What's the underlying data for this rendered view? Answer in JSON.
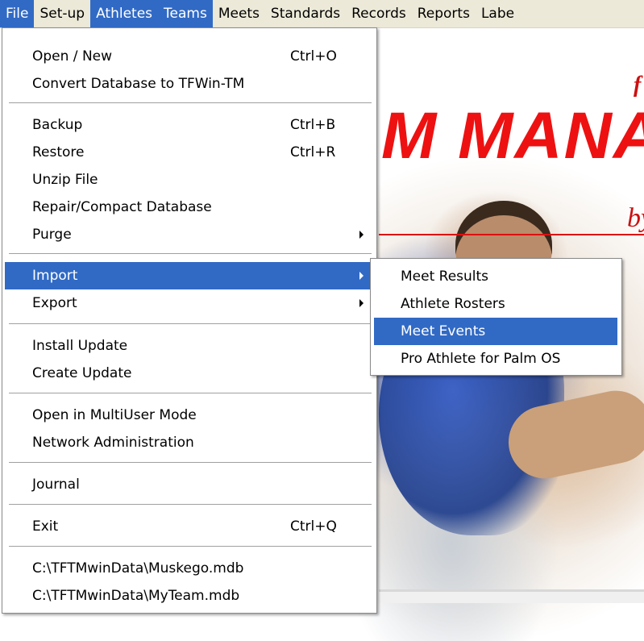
{
  "menubar": {
    "items": [
      "File",
      "Set-up",
      "Athletes",
      "Teams",
      "Meets",
      "Standards",
      "Records",
      "Reports",
      "Labe"
    ]
  },
  "file_menu": {
    "open_new": {
      "label": "Open / New",
      "shortcut": "Ctrl+O"
    },
    "convert": {
      "label": "Convert Database to TFWin-TM"
    },
    "backup": {
      "label": "Backup",
      "shortcut": "Ctrl+B"
    },
    "restore": {
      "label": "Restore",
      "shortcut": "Ctrl+R"
    },
    "unzip": {
      "label": "Unzip File"
    },
    "repair": {
      "label": "Repair/Compact Database"
    },
    "purge": {
      "label": "Purge"
    },
    "import": {
      "label": "Import"
    },
    "export": {
      "label": "Export"
    },
    "install_update": {
      "label": "Install Update"
    },
    "create_update": {
      "label": "Create Update"
    },
    "multiuser": {
      "label": "Open in MultiUser Mode"
    },
    "network_admin": {
      "label": "Network Administration"
    },
    "journal": {
      "label": "Journal"
    },
    "exit": {
      "label": "Exit",
      "shortcut": "Ctrl+Q"
    },
    "recent": [
      "C:\\TFTMwinData\\Muskego.mdb",
      "C:\\TFTMwinData\\MyTeam.mdb"
    ]
  },
  "import_menu": {
    "items": [
      "Meet Results",
      "Athlete Rosters",
      "Meet Events",
      "Pro Athlete for Palm OS"
    ],
    "highlighted": "Meet Events"
  },
  "splash": {
    "logo_text": "M MANA",
    "byline": "by",
    "top_fragment": "f"
  },
  "colors": {
    "menu_highlight": "#316ac5",
    "logo_red": "#ee1111",
    "menubar_bg": "#ece9d8"
  }
}
